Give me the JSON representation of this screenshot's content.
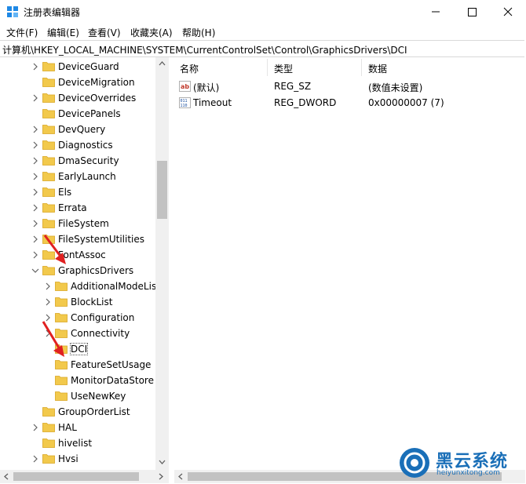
{
  "window": {
    "title": "注册表编辑器",
    "icon": "regedit-icon"
  },
  "menu": [
    {
      "label": "文件(F)"
    },
    {
      "label": "编辑(E)"
    },
    {
      "label": "查看(V)"
    },
    {
      "label": "收藏夹(A)"
    },
    {
      "label": "帮助(H)"
    }
  ],
  "address": "计算机\\HKEY_LOCAL_MACHINE\\SYSTEM\\CurrentControlSet\\Control\\GraphicsDrivers\\DCI",
  "tree": [
    {
      "label": "DeviceGuard",
      "expander": "collapsed"
    },
    {
      "label": "DeviceMigration",
      "expander": "none"
    },
    {
      "label": "DeviceOverrides",
      "expander": "collapsed"
    },
    {
      "label": "DevicePanels",
      "expander": "none"
    },
    {
      "label": "DevQuery",
      "expander": "collapsed"
    },
    {
      "label": "Diagnostics",
      "expander": "collapsed"
    },
    {
      "label": "DmaSecurity",
      "expander": "collapsed"
    },
    {
      "label": "EarlyLaunch",
      "expander": "collapsed"
    },
    {
      "label": "Els",
      "expander": "collapsed"
    },
    {
      "label": "Errata",
      "expander": "collapsed"
    },
    {
      "label": "FileSystem",
      "expander": "collapsed"
    },
    {
      "label": "FileSystemUtilities",
      "expander": "collapsed"
    },
    {
      "label": "FontAssoc",
      "expander": "collapsed"
    },
    {
      "label": "GraphicsDrivers",
      "expander": "expanded"
    },
    {
      "label": "AdditionalModeLis",
      "expander": "collapsed"
    },
    {
      "label": "BlockList",
      "expander": "collapsed"
    },
    {
      "label": "Configuration",
      "expander": "collapsed"
    },
    {
      "label": "Connectivity",
      "expander": "collapsed"
    },
    {
      "label": "DCI",
      "expander": "none"
    },
    {
      "label": "FeatureSetUsage",
      "expander": "none"
    },
    {
      "label": "MonitorDataStore",
      "expander": "none"
    },
    {
      "label": "UseNewKey",
      "expander": "none"
    },
    {
      "label": "GroupOrderList",
      "expander": "none"
    },
    {
      "label": "HAL",
      "expander": "collapsed"
    },
    {
      "label": "hivelist",
      "expander": "none"
    },
    {
      "label": "Hvsi",
      "expander": "collapsed"
    }
  ],
  "list": {
    "headers": {
      "name": "名称",
      "type": "类型",
      "data": "数据"
    },
    "rows": [
      {
        "icon": "string-value-icon",
        "name": "(默认)",
        "type": "REG_SZ",
        "data": "(数值未设置)"
      },
      {
        "icon": "dword-value-icon",
        "name": "Timeout",
        "type": "REG_DWORD",
        "data": "0x00000007 (7)"
      }
    ]
  },
  "watermark": {
    "title": "黑云系统",
    "url": "heiyunxitong.com"
  },
  "colors": {
    "folder": "#f2c94c",
    "arrow": "#e02020",
    "brand": "#1a6fb8"
  }
}
